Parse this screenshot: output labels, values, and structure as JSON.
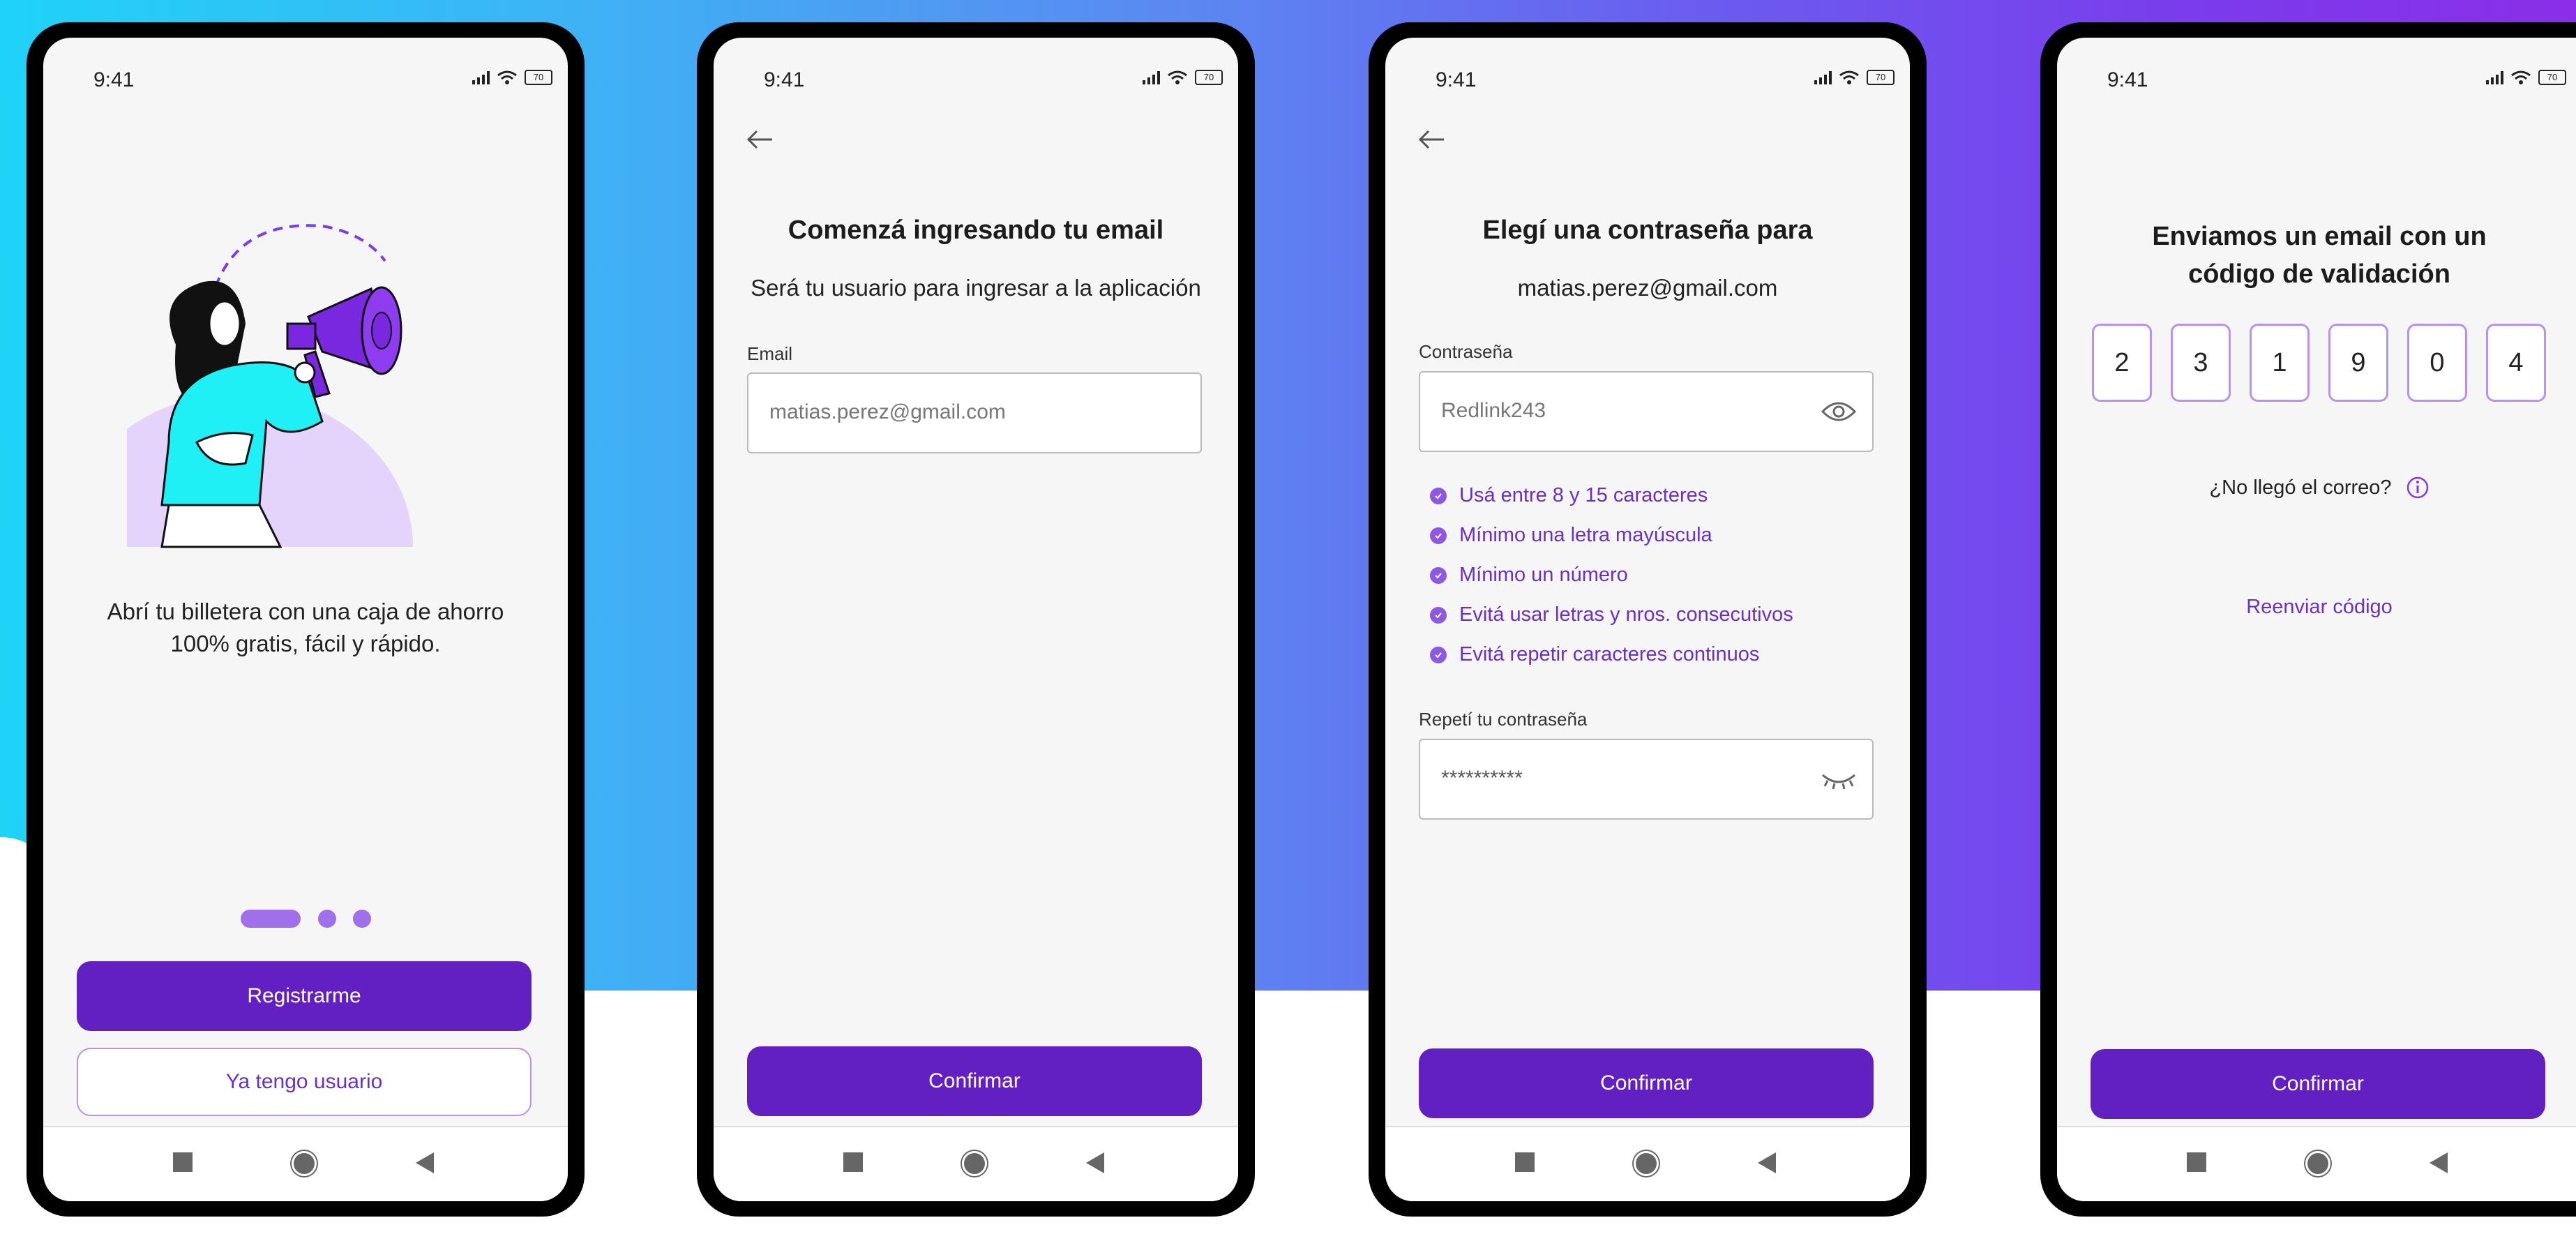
{
  "status": {
    "time": "9:41",
    "battery": "70"
  },
  "screen1": {
    "tagline_line1": "Abrí tu billetera con una caja de ahorro",
    "tagline_line2": "100% gratis, fácil y rápido.",
    "register_label": "Registrarme",
    "have_user_label": "Ya tengo usuario"
  },
  "screen2": {
    "title": "Comenzá ingresando tu email",
    "subtitle": "Será tu usuario para ingresar a la aplicación",
    "email_label": "Email",
    "email_value": "matias.perez@gmail.com",
    "confirm_label": "Confirmar"
  },
  "screen3": {
    "title": "Elegí una contraseña para",
    "email": "matias.perez@gmail.com",
    "password_label": "Contraseña",
    "password_value": "Redlink243",
    "rules": [
      "Usá entre 8 y 15 caracteres",
      "Mínimo una letra mayúscula",
      "Mínimo un número",
      "Evitá usar letras y nros. consecutivos",
      "Evitá repetir caracteres continuos"
    ],
    "repeat_label": "Repetí tu contraseña",
    "repeat_value": "**********",
    "confirm_label": "Confirmar"
  },
  "screen4": {
    "title_line1": "Enviamos un email con un",
    "title_line2": "código de validación",
    "code": [
      "2",
      "3",
      "1",
      "9",
      "0",
      "4"
    ],
    "not_received": "¿No llegó el correo?",
    "resend": "Reenviar código",
    "confirm_label": "Confirmar"
  },
  "colors": {
    "primary": "#6220c2",
    "accent_purple": "#8f58e3",
    "outline": "#b792f0",
    "illustration_cyan": "#1ef0f5"
  }
}
